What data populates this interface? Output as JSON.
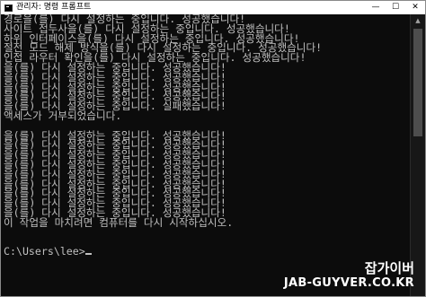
{
  "window": {
    "title": "관리자: 명령 프롬프트",
    "controls": {
      "minimize": "—",
      "maximize": "☐",
      "close": "✕"
    }
  },
  "console": {
    "lines": [
      "경로을(를) 다시 설정하는 중입니다. 성공했습니다!",
      "사이트 접두사을(를) 다시 설정하는 중입니다. 성공했습니다!",
      "하위 인터페이스을(를) 다시 설정하는 중입니다. 성공했습니다!",
      "절전 모드 해제 방식을(를) 다시 설정하는 중입니다. 성공했습니다!",
      "인접 라우터 확인을(를) 다시 설정하는 중입니다. 성공했습니다!",
      "을(를) 다시 설정하는 중입니다. 성공했습니다!",
      "을(를) 다시 설정하는 중입니다. 성공했습니다!",
      "을(를) 다시 설정하는 중입니다. 성공했습니다!",
      "을(를) 다시 설정하는 중입니다. 성공했습니다!",
      "을(를) 다시 설정하는 중입니다. 실패했습니다!",
      "액세스가 거부되었습니다.",
      "",
      "을(를) 다시 설정하는 중입니다. 성공했습니다!",
      "을(를) 다시 설정하는 중입니다. 성공했습니다!",
      "을(를) 다시 설정하는 중입니다. 성공했습니다!",
      "을(를) 다시 설정하는 중입니다. 성공했습니다!",
      "을(를) 다시 설정하는 중입니다. 성공했습니다!",
      "을(를) 다시 설정하는 중입니다. 성공했습니다!",
      "을(를) 다시 설정하는 중입니다. 성공했습니다!",
      "을(를) 다시 설정하는 중입니다. 성공했습니다!",
      "을(를) 다시 설정하는 중입니다. 성공했습니다!",
      "이 작업을 마치려면 컴퓨터를 다시 시작하십시오.",
      "",
      ""
    ],
    "prompt": "C:\\Users\\lee>"
  },
  "watermark": {
    "korean": "잡가이버",
    "domain": "JAB-GUYVER.CO.KR"
  },
  "colors": {
    "console_bg": "#0c0c0c",
    "console_text": "#c0c0c0",
    "titlebar_bg": "#ffffff"
  }
}
